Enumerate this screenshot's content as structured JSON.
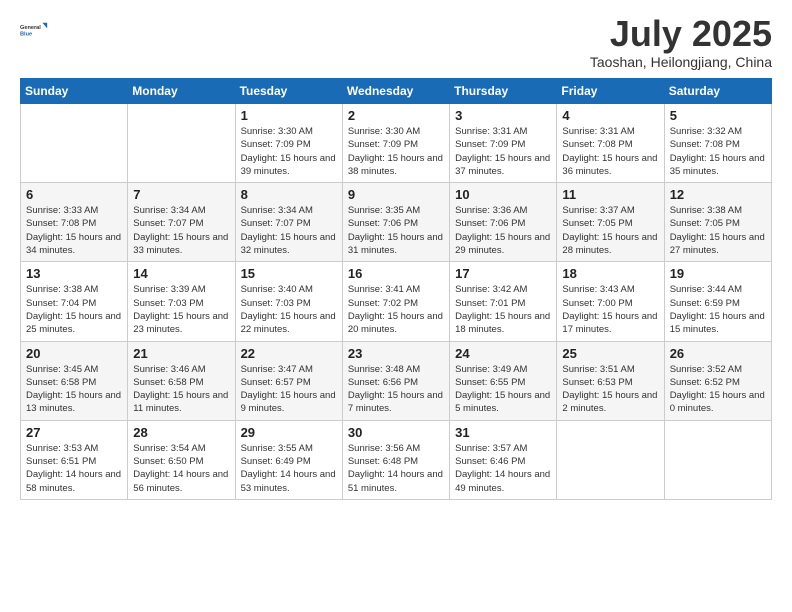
{
  "logo": {
    "text_general": "General",
    "text_blue": "Blue"
  },
  "header": {
    "month": "July 2025",
    "location": "Taoshan, Heilongjiang, China"
  },
  "weekdays": [
    "Sunday",
    "Monday",
    "Tuesday",
    "Wednesday",
    "Thursday",
    "Friday",
    "Saturday"
  ],
  "weeks": [
    [
      {
        "day": "",
        "sunrise": "",
        "sunset": "",
        "daylight": ""
      },
      {
        "day": "",
        "sunrise": "",
        "sunset": "",
        "daylight": ""
      },
      {
        "day": "1",
        "sunrise": "Sunrise: 3:30 AM",
        "sunset": "Sunset: 7:09 PM",
        "daylight": "Daylight: 15 hours and 39 minutes."
      },
      {
        "day": "2",
        "sunrise": "Sunrise: 3:30 AM",
        "sunset": "Sunset: 7:09 PM",
        "daylight": "Daylight: 15 hours and 38 minutes."
      },
      {
        "day": "3",
        "sunrise": "Sunrise: 3:31 AM",
        "sunset": "Sunset: 7:09 PM",
        "daylight": "Daylight: 15 hours and 37 minutes."
      },
      {
        "day": "4",
        "sunrise": "Sunrise: 3:31 AM",
        "sunset": "Sunset: 7:08 PM",
        "daylight": "Daylight: 15 hours and 36 minutes."
      },
      {
        "day": "5",
        "sunrise": "Sunrise: 3:32 AM",
        "sunset": "Sunset: 7:08 PM",
        "daylight": "Daylight: 15 hours and 35 minutes."
      }
    ],
    [
      {
        "day": "6",
        "sunrise": "Sunrise: 3:33 AM",
        "sunset": "Sunset: 7:08 PM",
        "daylight": "Daylight: 15 hours and 34 minutes."
      },
      {
        "day": "7",
        "sunrise": "Sunrise: 3:34 AM",
        "sunset": "Sunset: 7:07 PM",
        "daylight": "Daylight: 15 hours and 33 minutes."
      },
      {
        "day": "8",
        "sunrise": "Sunrise: 3:34 AM",
        "sunset": "Sunset: 7:07 PM",
        "daylight": "Daylight: 15 hours and 32 minutes."
      },
      {
        "day": "9",
        "sunrise": "Sunrise: 3:35 AM",
        "sunset": "Sunset: 7:06 PM",
        "daylight": "Daylight: 15 hours and 31 minutes."
      },
      {
        "day": "10",
        "sunrise": "Sunrise: 3:36 AM",
        "sunset": "Sunset: 7:06 PM",
        "daylight": "Daylight: 15 hours and 29 minutes."
      },
      {
        "day": "11",
        "sunrise": "Sunrise: 3:37 AM",
        "sunset": "Sunset: 7:05 PM",
        "daylight": "Daylight: 15 hours and 28 minutes."
      },
      {
        "day": "12",
        "sunrise": "Sunrise: 3:38 AM",
        "sunset": "Sunset: 7:05 PM",
        "daylight": "Daylight: 15 hours and 27 minutes."
      }
    ],
    [
      {
        "day": "13",
        "sunrise": "Sunrise: 3:38 AM",
        "sunset": "Sunset: 7:04 PM",
        "daylight": "Daylight: 15 hours and 25 minutes."
      },
      {
        "day": "14",
        "sunrise": "Sunrise: 3:39 AM",
        "sunset": "Sunset: 7:03 PM",
        "daylight": "Daylight: 15 hours and 23 minutes."
      },
      {
        "day": "15",
        "sunrise": "Sunrise: 3:40 AM",
        "sunset": "Sunset: 7:03 PM",
        "daylight": "Daylight: 15 hours and 22 minutes."
      },
      {
        "day": "16",
        "sunrise": "Sunrise: 3:41 AM",
        "sunset": "Sunset: 7:02 PM",
        "daylight": "Daylight: 15 hours and 20 minutes."
      },
      {
        "day": "17",
        "sunrise": "Sunrise: 3:42 AM",
        "sunset": "Sunset: 7:01 PM",
        "daylight": "Daylight: 15 hours and 18 minutes."
      },
      {
        "day": "18",
        "sunrise": "Sunrise: 3:43 AM",
        "sunset": "Sunset: 7:00 PM",
        "daylight": "Daylight: 15 hours and 17 minutes."
      },
      {
        "day": "19",
        "sunrise": "Sunrise: 3:44 AM",
        "sunset": "Sunset: 6:59 PM",
        "daylight": "Daylight: 15 hours and 15 minutes."
      }
    ],
    [
      {
        "day": "20",
        "sunrise": "Sunrise: 3:45 AM",
        "sunset": "Sunset: 6:58 PM",
        "daylight": "Daylight: 15 hours and 13 minutes."
      },
      {
        "day": "21",
        "sunrise": "Sunrise: 3:46 AM",
        "sunset": "Sunset: 6:58 PM",
        "daylight": "Daylight: 15 hours and 11 minutes."
      },
      {
        "day": "22",
        "sunrise": "Sunrise: 3:47 AM",
        "sunset": "Sunset: 6:57 PM",
        "daylight": "Daylight: 15 hours and 9 minutes."
      },
      {
        "day": "23",
        "sunrise": "Sunrise: 3:48 AM",
        "sunset": "Sunset: 6:56 PM",
        "daylight": "Daylight: 15 hours and 7 minutes."
      },
      {
        "day": "24",
        "sunrise": "Sunrise: 3:49 AM",
        "sunset": "Sunset: 6:55 PM",
        "daylight": "Daylight: 15 hours and 5 minutes."
      },
      {
        "day": "25",
        "sunrise": "Sunrise: 3:51 AM",
        "sunset": "Sunset: 6:53 PM",
        "daylight": "Daylight: 15 hours and 2 minutes."
      },
      {
        "day": "26",
        "sunrise": "Sunrise: 3:52 AM",
        "sunset": "Sunset: 6:52 PM",
        "daylight": "Daylight: 15 hours and 0 minutes."
      }
    ],
    [
      {
        "day": "27",
        "sunrise": "Sunrise: 3:53 AM",
        "sunset": "Sunset: 6:51 PM",
        "daylight": "Daylight: 14 hours and 58 minutes."
      },
      {
        "day": "28",
        "sunrise": "Sunrise: 3:54 AM",
        "sunset": "Sunset: 6:50 PM",
        "daylight": "Daylight: 14 hours and 56 minutes."
      },
      {
        "day": "29",
        "sunrise": "Sunrise: 3:55 AM",
        "sunset": "Sunset: 6:49 PM",
        "daylight": "Daylight: 14 hours and 53 minutes."
      },
      {
        "day": "30",
        "sunrise": "Sunrise: 3:56 AM",
        "sunset": "Sunset: 6:48 PM",
        "daylight": "Daylight: 14 hours and 51 minutes."
      },
      {
        "day": "31",
        "sunrise": "Sunrise: 3:57 AM",
        "sunset": "Sunset: 6:46 PM",
        "daylight": "Daylight: 14 hours and 49 minutes."
      },
      {
        "day": "",
        "sunrise": "",
        "sunset": "",
        "daylight": ""
      },
      {
        "day": "",
        "sunrise": "",
        "sunset": "",
        "daylight": ""
      }
    ]
  ],
  "colors": {
    "header_bg": "#1a6bb5",
    "alt_row": "#f5f5f5"
  }
}
